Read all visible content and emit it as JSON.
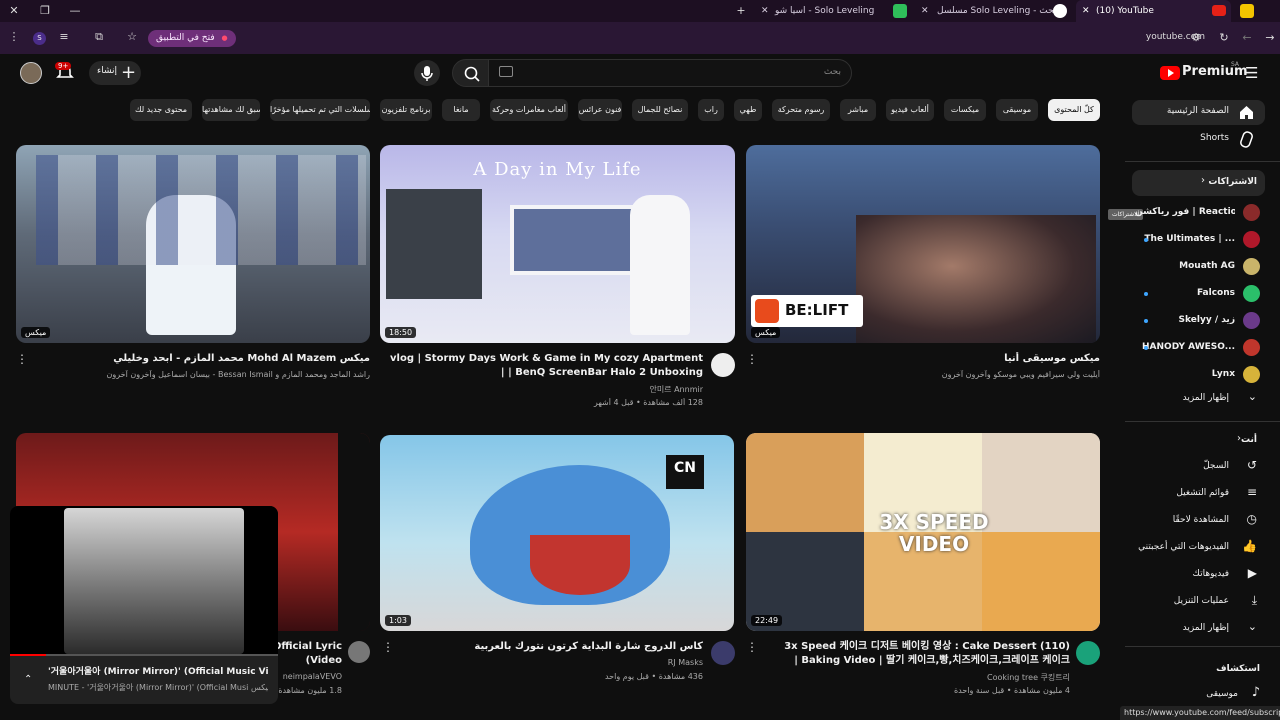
{
  "browser": {
    "tabs": [
      {
        "title": "(10) YouTube"
      },
      {
        "title": "مسلسل Solo Leveling - بحث Goo"
      },
      {
        "title": "اسيا شو - Solo Leveling"
      }
    ],
    "open_in_app": "فتح في التطبيق",
    "url": "youtube.com",
    "status_url": "https://www.youtube.com/feed/subscriptions"
  },
  "header": {
    "logo": "Premium",
    "logo_badge": "SA",
    "search_placeholder": "بحث",
    "create_label": "إنشاء",
    "notif_count": "9+"
  },
  "chips": [
    "كلّ المحتوى",
    "موسيقى",
    "ميكسات",
    "ألعاب فيديو",
    "مباشر",
    "رسوم متحركة",
    "طهي",
    "راب",
    "نصائح للجمال",
    "فنون عرائس",
    "ألعاب مغامرات وحركة",
    "مانغا",
    "برنامج تلفزيون",
    "المسلسلات التي تم تحميلها مؤخرًا",
    "فيديوهات سبق لك مشاهدتها",
    "محتوى جديد لك"
  ],
  "sidebar": {
    "home": "الصفحة الرئيسية",
    "shorts": "Shorts",
    "subscriptions": "الاشتراكات",
    "tooltip": "الاشتراكات",
    "channels": [
      {
        "name": "فور رياكشن | Reaction",
        "color": "#8a2a2a",
        "dot": false
      },
      {
        "name": "The Ultimates | ...",
        "color": "#b0182a",
        "dot": true
      },
      {
        "name": "Mouath AG",
        "color": "#c9b46a",
        "dot": false
      },
      {
        "name": "Falcons",
        "color": "#2bbf6a",
        "dot": true
      },
      {
        "name": "Skelyy / زيد",
        "color": "#6b3a8a",
        "dot": true
      },
      {
        "name": "HANODY AWESO...",
        "color": "#c0362c",
        "dot": true
      },
      {
        "name": "Lynx",
        "color": "#d6b33a",
        "dot": false
      }
    ],
    "show_more": "إظهار المزيد",
    "you": "أنت",
    "you_items": [
      "السجلّ",
      "قوائم التشغيل",
      "المشاهدة لاحقًا",
      "الفيديوهات التي أعجبتني",
      "فيديوهاتك",
      "عمليات التنزيل"
    ],
    "show_more_2": "إظهار المزيد",
    "explore": "استكشاف",
    "music": "موسيقى"
  },
  "videos": [
    {
      "title": "ميكس Mohd Al Mazem محمد المازم - ابحد وخليلي",
      "meta1": "راشد الماجد ومحمد المازم و Bessan Ismail - بيسان اسماعيل وآخرون آخرون",
      "meta2": "",
      "badge": "ميكس"
    },
    {
      "title": "vlog | Stormy Days Work & Game in My cozy Apartment | BenQ ScreenBar Halo 2 Unboxing |",
      "meta1": "안미르 Annmir",
      "meta2": "128 ألف مشاهدة • قبل 4 أشهر",
      "badge": "18:50",
      "overlay": "A Day in My Life"
    },
    {
      "title": "ميكس موسيقى أنيا",
      "meta1": "أيليت ولي سيرافيم ويبي موسكو وآخرون آخرون",
      "meta2": "",
      "badge": "ميكس",
      "logo": "BE:LIFT"
    },
    {
      "title": "Official Lyric Video)",
      "meta1": "neimpalaVEVO",
      "meta2": "1.8 مليون مشاهدة",
      "badge": ""
    },
    {
      "title": "كاس الدروج شارة البداية كرتون نتورك بالعربية",
      "meta1": "RJ Masks",
      "meta2": "436 مشاهدة • قبل يوم واحد",
      "badge": "1:03",
      "logo": "CN"
    },
    {
      "title": "(110) 3x Speed 케이크 디저트 베이킹 영상 : Cake Dessert Baking Video | 딸기 케이크,빵,치즈케이크,크레이프 케이크 |",
      "meta1": "Cooking tree 쿠킹트리",
      "meta2": "4 مليون مشاهدة • قبل سنة واحدة",
      "badge": "22:49",
      "overlay": "3X SPEED VIDEO"
    }
  ],
  "miniplayer": {
    "title": "'거울아거울아 (Mirror Mirror)' (Official Music Video) ...ميكس",
    "sub": "MINUTE - '거울아거울아 (Mirror Mirror)' (Official Musi ميكس"
  }
}
